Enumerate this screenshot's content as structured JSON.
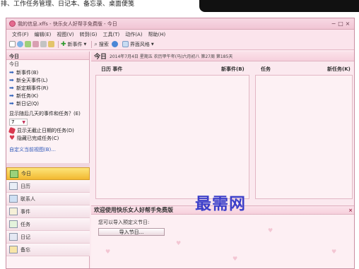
{
  "article_text": "排、工作任务管理、日记本、备忘录、桌面便笺",
  "window": {
    "title": "我的信息.xffs - 快乐女人好帮手免费版 - 今日",
    "controls": [
      "−",
      "□",
      "×"
    ]
  },
  "menu": [
    "文件(F)",
    "编辑(E)",
    "视图(V)",
    "转到(G)",
    "工具(T)",
    "动作(A)",
    "帮助(H)"
  ],
  "toolbar": {
    "new_event": "新事件",
    "search": "搜索",
    "skin": "界面风格"
  },
  "left_panel": {
    "header": "今日",
    "subheader": "今日",
    "quick_tasks": [
      "新事件(B)",
      "新全天事件(L)",
      "新定期事件(R)",
      "新任务(K)",
      "新日记(Q)"
    ],
    "question": "显示随后几天的事件和任务？(E)",
    "days_value": "7",
    "options": [
      "显示无截止日期的任务(D)",
      "隐藏已完成任务(C)"
    ],
    "custom_view_link": "自定义当前视图(B)..."
  },
  "nav": [
    {
      "label": "今日",
      "icon": "today-icon",
      "active": true
    },
    {
      "label": "日历",
      "icon": "calendar-icon",
      "active": false
    },
    {
      "label": "联系人",
      "icon": "contacts-icon",
      "active": false
    },
    {
      "label": "事件",
      "icon": "event-icon",
      "active": false
    },
    {
      "label": "任务",
      "icon": "task-icon",
      "active": false
    },
    {
      "label": "日记",
      "icon": "diary-icon",
      "active": false
    },
    {
      "label": "备忘",
      "icon": "memo-icon",
      "active": false
    }
  ],
  "main": {
    "today_label": "今日",
    "date_text": "2014年7月4日 星期五 农历甲午年(马)六月初八 第27周 第185天",
    "col_events_left": "日历 事件",
    "col_events_right": "新事件(B)",
    "col_tasks_left": "任务",
    "col_tasks_right": "新任务(K)"
  },
  "welcome": {
    "title": "欢迎使用快乐女人好帮手免费版",
    "close": "×",
    "body": "您可以导入预定义节日:",
    "import_button": "导入节日..."
  },
  "watermark": "最需网",
  "colors": {
    "accent": "#e46a8f",
    "active_nav": "#f2b830",
    "link": "#2b55b8",
    "watermark": "#3c3fc9"
  }
}
